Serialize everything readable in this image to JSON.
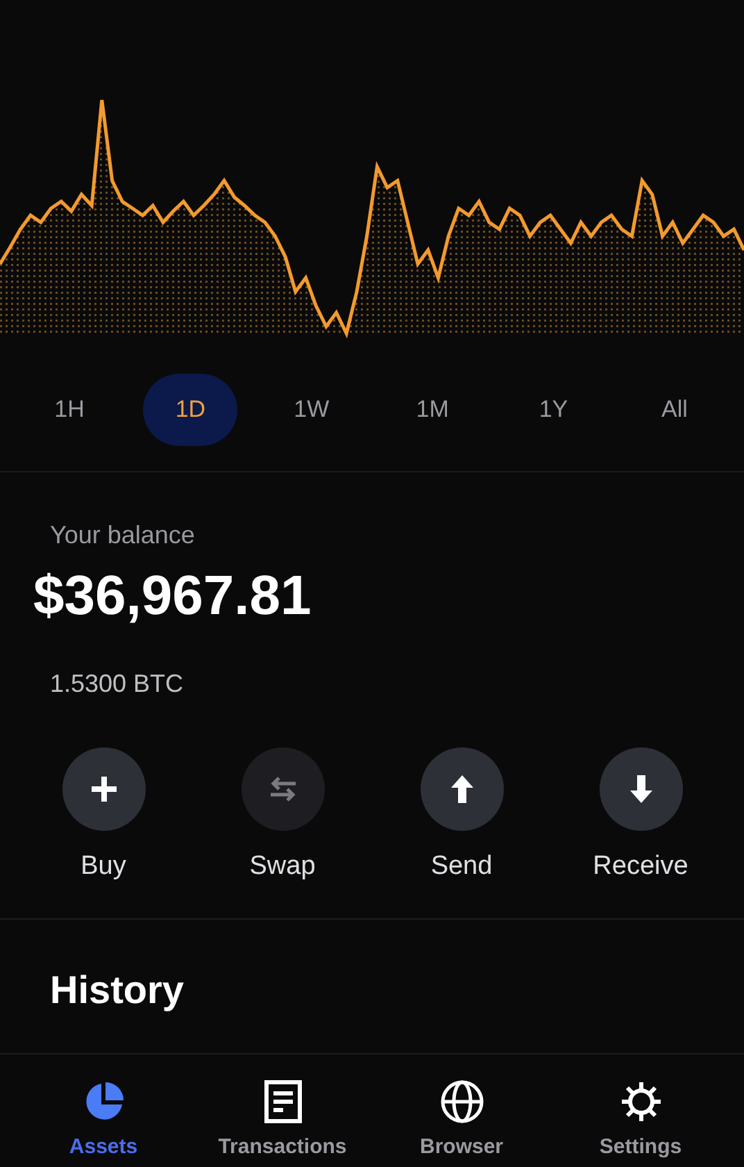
{
  "periods": [
    {
      "label": "1H",
      "selected": false
    },
    {
      "label": "1D",
      "selected": true
    },
    {
      "label": "1W",
      "selected": false
    },
    {
      "label": "1M",
      "selected": false
    },
    {
      "label": "1Y",
      "selected": false
    },
    {
      "label": "All",
      "selected": false
    }
  ],
  "balance": {
    "label": "Your balance",
    "amount": "$36,967.81",
    "crypto": "1.5300 BTC"
  },
  "actions": [
    {
      "kind": "plus",
      "label": "Buy",
      "disabled": false
    },
    {
      "kind": "swap",
      "label": "Swap",
      "disabled": true
    },
    {
      "kind": "send",
      "label": "Send",
      "disabled": false
    },
    {
      "kind": "receive",
      "label": "Receive",
      "disabled": false
    }
  ],
  "history": {
    "title": "History"
  },
  "nav": [
    {
      "kind": "assets",
      "label": "Assets",
      "selected": true
    },
    {
      "kind": "transactions",
      "label": "Transactions",
      "selected": false
    },
    {
      "kind": "browser",
      "label": "Browser",
      "selected": false
    },
    {
      "kind": "settings",
      "label": "Settings",
      "selected": false
    }
  ]
}
